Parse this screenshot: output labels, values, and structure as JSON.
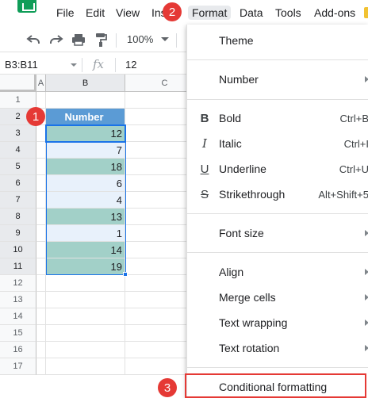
{
  "menubar": {
    "items": [
      "File",
      "Edit",
      "View",
      "Ins",
      "Format",
      "Data",
      "Tools",
      "Add-ons"
    ]
  },
  "toolbar": {
    "zoom": "100%",
    "icons": [
      "undo-icon",
      "redo-icon",
      "print-icon",
      "paint-format-icon"
    ]
  },
  "formula_bar": {
    "name_box": "B3:B11",
    "fx": "fx",
    "value": "12"
  },
  "grid": {
    "columns": [
      "A",
      "B",
      "C"
    ],
    "rows": [
      "1",
      "2",
      "3",
      "4",
      "5",
      "6",
      "7",
      "8",
      "9",
      "10",
      "11",
      "12",
      "13",
      "14",
      "15",
      "16",
      "17"
    ],
    "header_cell": "Number",
    "values": [
      "12",
      "7",
      "18",
      "6",
      "4",
      "13",
      "1",
      "14",
      "19"
    ],
    "colors": {
      "header_fill": "#5b9bd5",
      "teal_fill": "#a2d0c8",
      "light_fill": "#e8f1fb"
    }
  },
  "badges": [
    "1",
    "2",
    "3"
  ],
  "format_menu": {
    "items": [
      {
        "label": "Theme"
      },
      {
        "label": "Number"
      },
      {
        "label": "Bold",
        "shortcut": "Ctrl+B",
        "icon": "B"
      },
      {
        "label": "Italic",
        "shortcut": "Ctrl+I",
        "icon": "I"
      },
      {
        "label": "Underline",
        "shortcut": "Ctrl+U",
        "icon": "U"
      },
      {
        "label": "Strikethrough",
        "shortcut": "Alt+Shift+5",
        "icon": "S"
      },
      {
        "label": "Font size"
      },
      {
        "label": "Align"
      },
      {
        "label": "Merge cells"
      },
      {
        "label": "Text wrapping"
      },
      {
        "label": "Text rotation"
      },
      {
        "label": "Conditional formatting"
      }
    ]
  },
  "colors": {
    "accent": "#1a73e8",
    "badge": "#e53935",
    "sheets_green": "#0f9d58"
  }
}
